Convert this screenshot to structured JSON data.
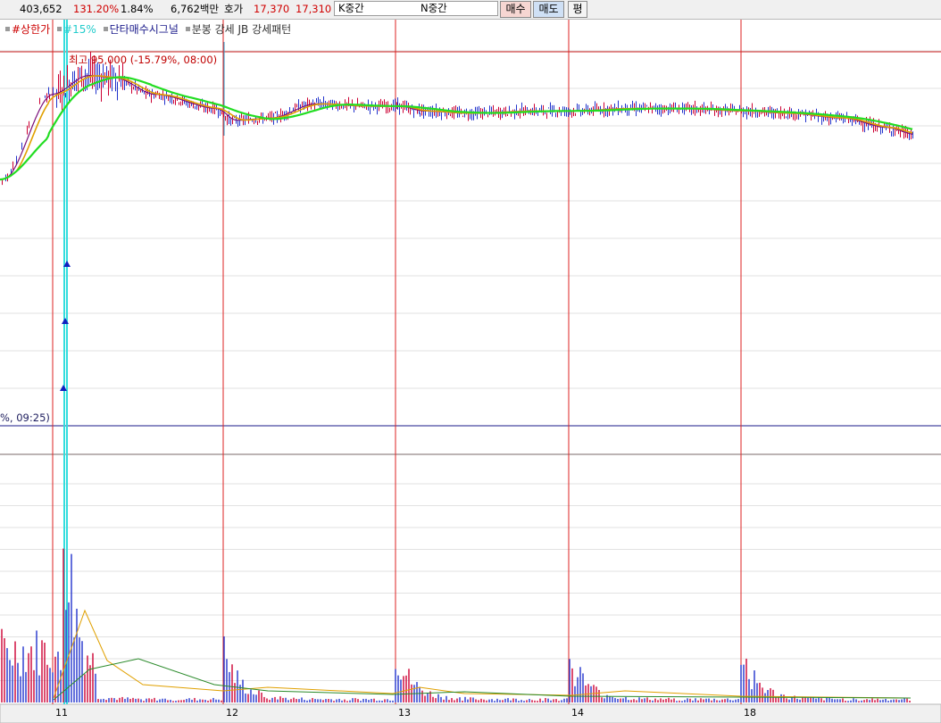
{
  "topbar": {
    "volume": "403,652",
    "vol_ratio": "131.20%",
    "turnover": "1.84%",
    "amount": "6,762백만",
    "hoga_label": "호가",
    "ask": "17,370",
    "bid": "17,310",
    "k_mid": "K중간",
    "n_mid": "N중간",
    "buy_label": "매수",
    "sell_label": "매도",
    "flat_label": "평"
  },
  "legend": {
    "upper_limit": "#상한가",
    "pct15": "#15%",
    "signal": "단타매수시그널",
    "pattern": "분봉 강세 JB 강세패턴"
  },
  "annotations": {
    "max": "최고 95,000 (-15.79%, 08:00)",
    "min": "%, 09:25)"
  },
  "colors": {
    "candle_up": "#cc0033",
    "candle_down": "#2233cc",
    "ma_short": "#7a0f7a",
    "ma_mid": "#e0a000",
    "ma_long": "#22dd22",
    "day_divider": "#dd2222",
    "signal_line": "#33dddd",
    "grid": "#e2e2e2"
  },
  "chart_data": {
    "type": "line",
    "x": [
      "11",
      "12",
      "13",
      "14",
      "18"
    ],
    "series": [
      {
        "values": [
          13.2,
          16.8,
          17.6,
          17.5,
          16.8,
          16.2,
          15.7,
          15.8,
          16.4,
          16.3,
          16.3,
          16.1,
          16.0,
          16.1,
          16.1,
          16.2,
          16.2,
          16.1,
          16.0,
          15.8,
          15.4,
          15.1
        ]
      }
    ]
  },
  "dates": [
    "11",
    "12",
    "13",
    "14",
    "18"
  ]
}
